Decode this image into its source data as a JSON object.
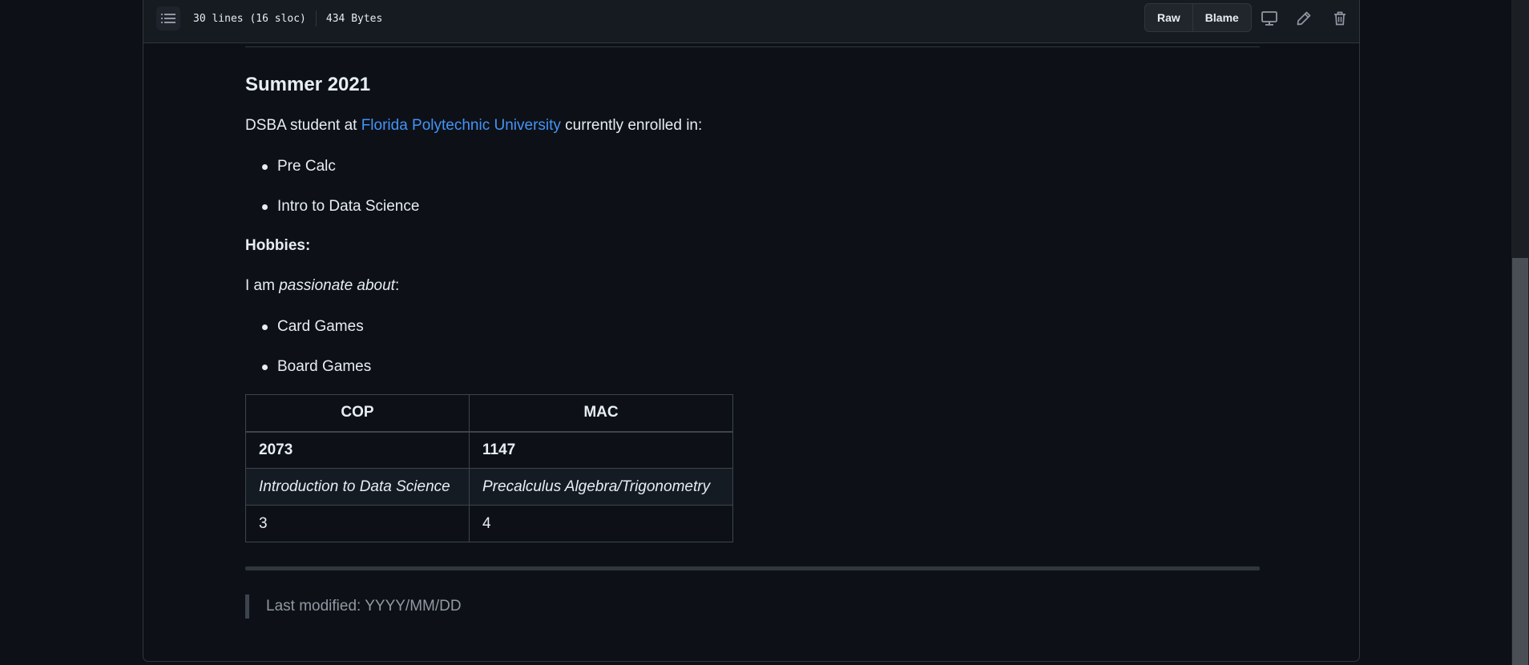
{
  "file_header": {
    "lines_info": "30 lines (16 sloc)",
    "size_info": "434 Bytes",
    "raw_label": "Raw",
    "blame_label": "Blame",
    "icons": [
      "outline-list-icon",
      "display-icon",
      "pencil-icon",
      "trash-icon"
    ]
  },
  "readme": {
    "heading": "Summer 2021",
    "intro_prefix": "DSBA student at ",
    "intro_link": "Florida Polytechnic University",
    "intro_suffix": " currently enrolled in:",
    "courses": [
      "Pre Calc",
      "Intro to Data Science"
    ],
    "hobbies_label": "Hobbies:",
    "passion_prefix": "I am ",
    "passion_emphasis": "passionate about",
    "passion_suffix": ":",
    "hobbies": [
      "Card Games",
      "Board Games"
    ],
    "table": {
      "headers": [
        "COP",
        "MAC"
      ],
      "rows": [
        [
          "2073",
          "1147"
        ],
        [
          "Introduction to Data Science",
          "Precalculus Algebra/Trigonometry"
        ],
        [
          "3",
          "4"
        ]
      ]
    },
    "footer_quote": "Last modified: YYYY/MM/DD"
  },
  "colors": {
    "background": "#0d1117",
    "header_bg": "#161b22",
    "border": "#30363d",
    "text": "#e6edf3",
    "link": "#4493f8",
    "muted": "#9198a1"
  }
}
